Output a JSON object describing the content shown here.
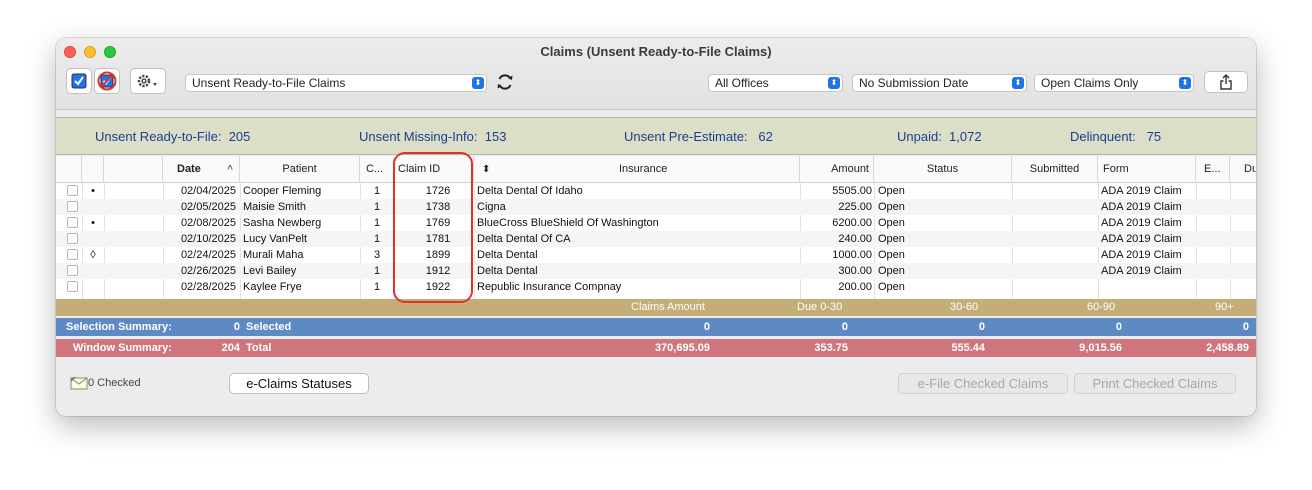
{
  "window": {
    "title": "Claims (Unsent Ready-to-File Claims)"
  },
  "toolbar": {
    "list_selector": "Unsent Ready-to-File Claims",
    "office_filter": "All Offices",
    "date_filter": "No Submission Date",
    "claims_filter": "Open Claims Only"
  },
  "summary": {
    "ready_label": "Unsent Ready-to-File:",
    "ready_value": "205",
    "missing_label": "Unsent Missing-Info:",
    "missing_value": "153",
    "pre_label": "Unsent Pre-Estimate:",
    "pre_value": "62",
    "unpaid_label": "Unpaid:",
    "unpaid_value": "1,072",
    "delinquent_label": "Delinquent:",
    "delinquent_value": "75"
  },
  "columns": {
    "date": "Date",
    "patient": "Patient",
    "c": "C...",
    "claim_id": "Claim ID",
    "insurance": "Insurance",
    "amount": "Amount",
    "status": "Status",
    "submitted": "Submitted",
    "form": "Form",
    "e": "E...",
    "du": "Du"
  },
  "rows": [
    {
      "mark": "•",
      "date": "02/04/2025",
      "patient": "Cooper Fleming",
      "c": "1",
      "claim_id": "1726",
      "insurance": "Delta Dental Of Idaho",
      "amount": "5505.00",
      "status": "Open",
      "form": "ADA 2019 Claim"
    },
    {
      "mark": "",
      "date": "02/05/2025",
      "patient": "Maisie Smith",
      "c": "1",
      "claim_id": "1738",
      "insurance": "Cigna",
      "amount": "225.00",
      "status": "Open",
      "form": "ADA 2019 Claim"
    },
    {
      "mark": "•",
      "date": "02/08/2025",
      "patient": "Sasha Newberg",
      "c": "1",
      "claim_id": "1769",
      "insurance": "BlueCross BlueShield Of Washington",
      "amount": "6200.00",
      "status": "Open",
      "form": "ADA 2019 Claim"
    },
    {
      "mark": "",
      "date": "02/10/2025",
      "patient": "Lucy VanPelt",
      "c": "1",
      "claim_id": "1781",
      "insurance": "Delta Dental Of CA",
      "amount": "240.00",
      "status": "Open",
      "form": "ADA 2019 Claim"
    },
    {
      "mark": "◊",
      "date": "02/24/2025",
      "patient": "Murali Maha",
      "c": "3",
      "claim_id": "1899",
      "insurance": "Delta Dental",
      "amount": "1000.00",
      "status": "Open",
      "form": "ADA 2019 Claim"
    },
    {
      "mark": "",
      "date": "02/26/2025",
      "patient": "Levi Bailey",
      "c": "1",
      "claim_id": "1912",
      "insurance": "Delta Dental",
      "amount": "300.00",
      "status": "Open",
      "form": "ADA 2019 Claim"
    },
    {
      "mark": "",
      "date": "02/28/2025",
      "patient": "Kaylee Frye",
      "c": "1",
      "claim_id": "1922",
      "insurance": "Republic Insurance Compnay",
      "amount": "200.00",
      "status": "Open",
      "form": ""
    }
  ],
  "aging": {
    "claims_amount": "Claims Amount",
    "due_0_30": "Due 0-30",
    "d30_60": "30-60",
    "d60_90": "60-90",
    "d90": "90+"
  },
  "selection_summary": {
    "label": "Selection Summary:",
    "count": "0",
    "selected_label": "Selected",
    "amount": "0",
    "due_0_30": "0",
    "d30_60": "0",
    "d60_90": "0",
    "d90": "0"
  },
  "window_summary": {
    "label": "Window Summary:",
    "count": "204",
    "total_label": "Total",
    "amount": "370,695.09",
    "due_0_30": "353.75",
    "d30_60": "555.44",
    "d60_90": "9,015.56",
    "d90": "2,458.89"
  },
  "footer": {
    "checked_label": "0 Checked",
    "eclaims_button": "e-Claims Statuses",
    "efile_button": "e-File Checked Claims",
    "print_button": "Print Checked Claims"
  },
  "colors": {
    "summary_text": "#1f3b8f",
    "aging_band": "#c5ad78",
    "selection_band": "#5e8ac4",
    "window_band": "#d0747d",
    "highlight": "#e0312a"
  }
}
